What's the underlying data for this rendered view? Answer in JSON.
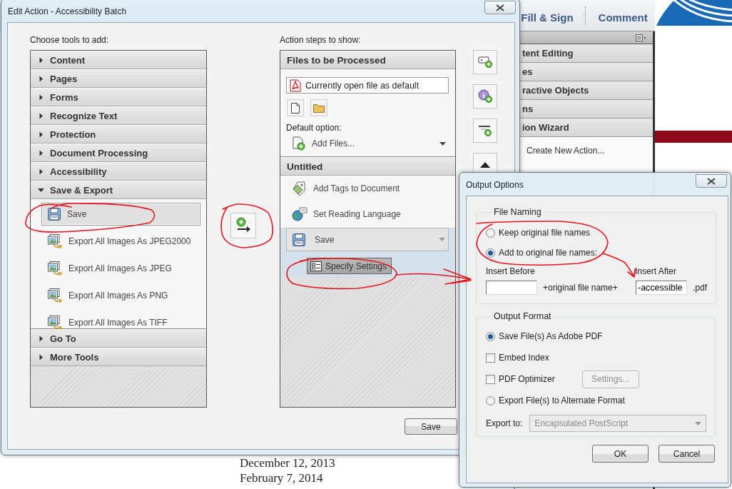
{
  "acrobat": {
    "toolbar_tabs": [
      {
        "label": "Fill & Sign"
      },
      {
        "label": "Comment"
      }
    ],
    "panel_sections": [
      "tent Editing",
      "es",
      "ractive Objects",
      "ns",
      "ion Wizard"
    ],
    "panel_items": [
      "Create New Action..."
    ],
    "document_lines": [
      "December 12, 2013",
      "February 7, 2014"
    ]
  },
  "edit_action": {
    "title": "Edit Action - Accessibility Batch",
    "tools_label": "Choose tools to add:",
    "tool_groups": [
      {
        "label": "Content",
        "expanded": false
      },
      {
        "label": "Pages",
        "expanded": false
      },
      {
        "label": "Forms",
        "expanded": false
      },
      {
        "label": "Recognize Text",
        "expanded": false
      },
      {
        "label": "Protection",
        "expanded": false
      },
      {
        "label": "Document Processing",
        "expanded": false
      },
      {
        "label": "Accessibility",
        "expanded": false
      },
      {
        "label": "Save & Export",
        "expanded": true,
        "items": [
          {
            "kind": "save",
            "label": "Save",
            "selected": true
          },
          {
            "kind": "export-images",
            "label": "Export All Images As JPEG2000",
            "selected": false
          },
          {
            "kind": "export-images",
            "label": "Export All Images As JPEG",
            "selected": false
          },
          {
            "kind": "export-images",
            "label": "Export All Images As PNG",
            "selected": false
          },
          {
            "kind": "export-images",
            "label": "Export All Images As TIFF",
            "selected": false
          }
        ]
      },
      {
        "label": "Go To",
        "expanded": false
      },
      {
        "label": "More Tools",
        "expanded": false
      }
    ],
    "steps_label": "Action steps to show:",
    "files_section": {
      "title": "Files to be Processed",
      "source_file": "Currently open file as default",
      "default_option_label": "Default option:",
      "default_option": "Add Files..."
    },
    "action_section": {
      "title": "Untitled",
      "steps": [
        {
          "kind": "tags",
          "label": "Add Tags to Document",
          "selected": false
        },
        {
          "kind": "language",
          "label": "Set Reading Language",
          "selected": false
        },
        {
          "kind": "save",
          "label": "Save",
          "selected": true,
          "settings_button": "Specify Settings"
        }
      ]
    },
    "buttons": [
      "Save"
    ]
  },
  "output_options": {
    "title": "Output Options",
    "file_naming": {
      "legend": "File Naming",
      "options": [
        {
          "label": "Keep original file names",
          "selected": false
        },
        {
          "label": "Add to original file names:",
          "selected": true
        }
      ],
      "insert_before_label": "Insert Before",
      "middle_text": "+original file name+",
      "insert_after_label": "Insert After",
      "insert_after_value": "-accessible",
      "extension": ".pdf"
    },
    "output_format": {
      "legend": "Output Format",
      "options": [
        {
          "kind": "radio",
          "label": "Save File(s) As Adobe PDF",
          "selected": true
        },
        {
          "kind": "checkbox",
          "label": "Embed Index",
          "checked": false
        },
        {
          "kind": "checkbox",
          "label": "PDF Optimizer",
          "checked": false,
          "button": {
            "label": "Settings...",
            "disabled": true
          }
        },
        {
          "kind": "radio",
          "label": "Export File(s) to Alternate Format",
          "selected": false
        }
      ],
      "export_to_label": "Export to:",
      "export_to": {
        "value": "Encapsulated PostScript",
        "disabled": true
      }
    },
    "buttons": [
      "OK",
      "Cancel"
    ]
  }
}
